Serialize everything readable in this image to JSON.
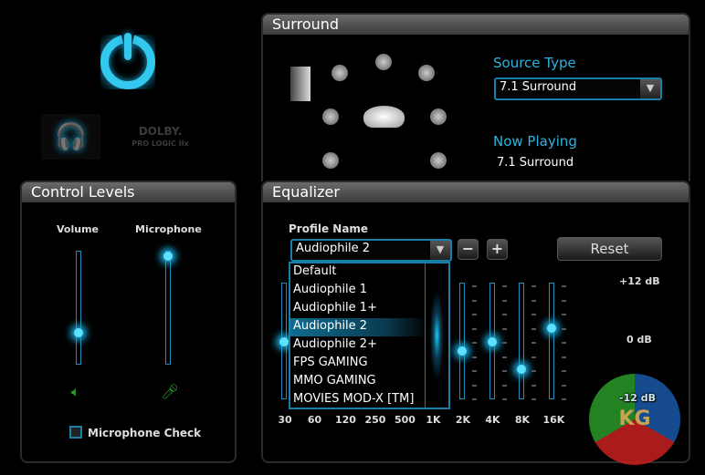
{
  "left": {
    "power": "power",
    "dolby_logo": "DOLBY. PRO LOGIC IIx"
  },
  "control_levels": {
    "title": "Control Levels",
    "volume_label": "Volume",
    "microphone_label": "Microphone",
    "volume_percent": 27,
    "microphone_percent": 100,
    "mic_check_label": "Microphone Check",
    "mic_check_checked": false
  },
  "surround": {
    "title": "Surround",
    "source_type_label": "Source Type",
    "source_type_value": "7.1 Surround",
    "now_playing_label": "Now Playing",
    "now_playing_value": "7.1 Surround"
  },
  "equalizer": {
    "title": "Equalizer",
    "profile_name_label": "Profile Name",
    "profile_value": "Audiophile 2",
    "minus": "−",
    "plus": "+",
    "reset": "Reset",
    "options": [
      "Default",
      "Audiophile 1",
      "Audiophile 1+",
      "Audiophile 2",
      "Audiophile 2+",
      "FPS GAMING",
      "MMO GAMING",
      "MOVIES MOD-X [TM]"
    ],
    "selected_index": 3,
    "db_top": "+12 dB",
    "db_mid": "0 dB",
    "db_bottom": "-12 dB",
    "bands": [
      {
        "freq": "30",
        "db": 0
      },
      {
        "freq": "60",
        "db": 0
      },
      {
        "freq": "120",
        "db": 0
      },
      {
        "freq": "250",
        "db": 0
      },
      {
        "freq": "500",
        "db": 2
      },
      {
        "freq": "1K",
        "db": 0
      },
      {
        "freq": "2K",
        "db": -2
      },
      {
        "freq": "4K",
        "db": 0
      },
      {
        "freq": "8K",
        "db": -6
      },
      {
        "freq": "16K",
        "db": 3
      }
    ]
  },
  "watermark": "KG",
  "colors": {
    "accent": "#2ab4e0"
  }
}
